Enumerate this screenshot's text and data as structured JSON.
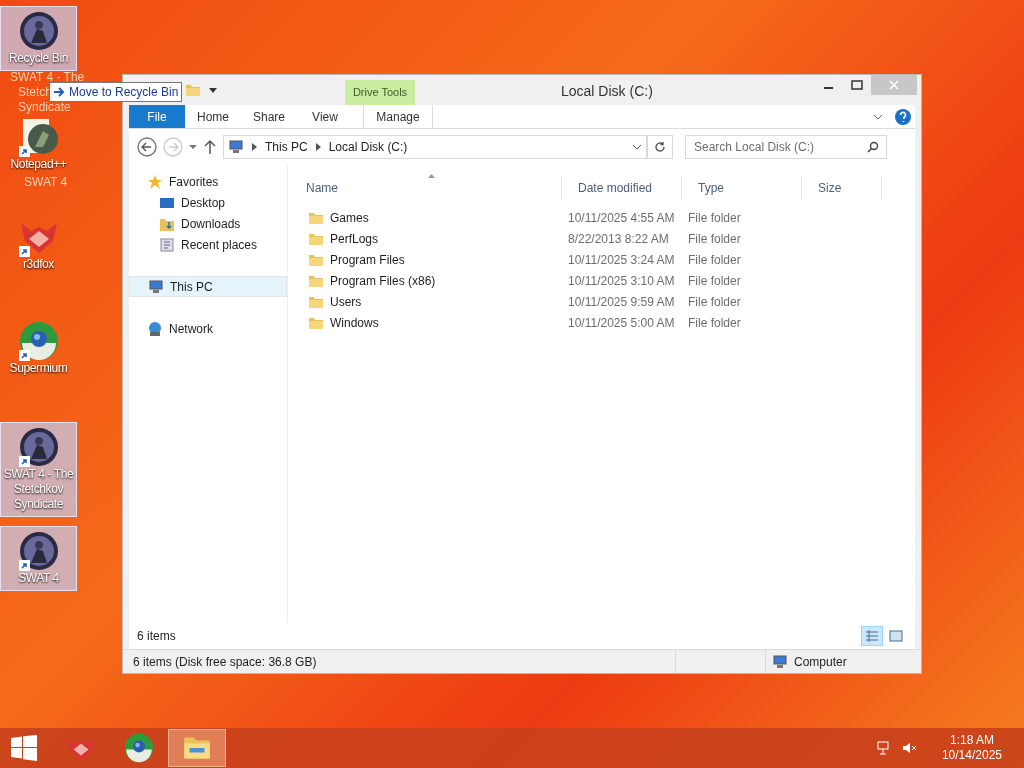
{
  "desktop": {
    "icons": [
      {
        "label": "Recycle Bin",
        "kind": "recycle",
        "selected": true
      },
      {
        "label": "Notepad++",
        "kind": "notepad",
        "selected": false
      },
      {
        "label": "r3dfox",
        "kind": "fox",
        "selected": false
      },
      {
        "label": "Supermium",
        "kind": "browser",
        "selected": false
      },
      {
        "label": "SWAT 4 - The Stetchkov Syndicate",
        "kind": "game",
        "selected": true
      },
      {
        "label": "SWAT 4",
        "kind": "game",
        "selected": true
      }
    ],
    "drag": {
      "labels": [
        "SWAT 4 - The",
        "Stetch",
        "Syndicate",
        "SWAT 4"
      ],
      "tooltip": "Move to Recycle Bin"
    }
  },
  "explorer": {
    "title": "Local Disk (C:)",
    "contextual_group": "Drive Tools",
    "tabs": [
      {
        "label": "File",
        "kind": "file"
      },
      {
        "label": "Home",
        "kind": "normal"
      },
      {
        "label": "Share",
        "kind": "normal"
      },
      {
        "label": "View",
        "kind": "normal"
      },
      {
        "label": "Manage",
        "kind": "contextual"
      }
    ],
    "address": [
      "This PC",
      "Local Disk (C:)"
    ],
    "search": {
      "placeholder": "Search Local Disk (C:)"
    },
    "nav": [
      {
        "label": "Favorites",
        "kind": "star",
        "selected": false,
        "children": [
          {
            "label": "Desktop",
            "kind": "desktop",
            "selected": false
          },
          {
            "label": "Downloads",
            "kind": "downloads",
            "selected": false
          },
          {
            "label": "Recent places",
            "kind": "recent",
            "selected": false
          }
        ]
      },
      {
        "label": "This PC",
        "kind": "pc",
        "selected": true
      },
      {
        "label": "Network",
        "kind": "network",
        "selected": false
      }
    ],
    "columns": [
      "Name",
      "Date modified",
      "Type",
      "Size"
    ],
    "rows": [
      {
        "name": "Games",
        "date": "10/11/2025 4:55 AM",
        "type": "File folder"
      },
      {
        "name": "PerfLogs",
        "date": "8/22/2013 8:22 AM",
        "type": "File folder"
      },
      {
        "name": "Program Files",
        "date": "10/11/2025 3:24 AM",
        "type": "File folder"
      },
      {
        "name": "Program Files (x86)",
        "date": "10/11/2025 3:10 AM",
        "type": "File folder"
      },
      {
        "name": "Users",
        "date": "10/11/2025 9:59 AM",
        "type": "File folder"
      },
      {
        "name": "Windows",
        "date": "10/11/2025 5:00 AM",
        "type": "File folder"
      }
    ],
    "item_count": "6 items",
    "views": [
      {
        "kind": "details",
        "selected": true
      },
      {
        "kind": "large",
        "selected": false
      }
    ],
    "status": {
      "text": "6 items (Disk free space: 36.8 GB)",
      "location": "Computer"
    }
  },
  "taskbar": {
    "buttons": [
      {
        "kind": "fox",
        "active": false
      },
      {
        "kind": "browser",
        "active": false
      },
      {
        "kind": "explorer",
        "active": true
      }
    ],
    "time": "1:18 AM",
    "date": "10/14/2025"
  }
}
